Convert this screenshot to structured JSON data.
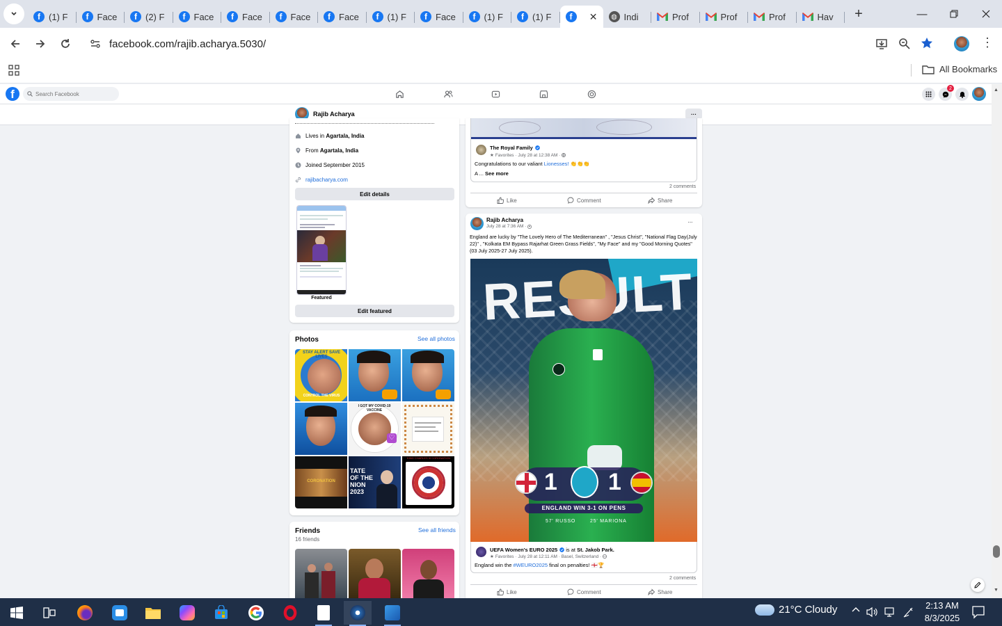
{
  "browser": {
    "tabs": [
      {
        "label": "(1) F",
        "icon": "facebook-icon"
      },
      {
        "label": "Face",
        "icon": "facebook-icon"
      },
      {
        "label": "(2) F",
        "icon": "facebook-icon"
      },
      {
        "label": "Face",
        "icon": "facebook-icon"
      },
      {
        "label": "Face",
        "icon": "facebook-icon"
      },
      {
        "label": "Face",
        "icon": "facebook-icon"
      },
      {
        "label": "Face",
        "icon": "facebook-icon"
      },
      {
        "label": "(1) F",
        "icon": "facebook-icon"
      },
      {
        "label": "Face",
        "icon": "facebook-icon"
      },
      {
        "label": "(1) F",
        "icon": "facebook-icon"
      },
      {
        "label": "(1) F",
        "icon": "facebook-icon"
      },
      {
        "label": "",
        "icon": "facebook-icon",
        "active": true
      },
      {
        "label": "Indi",
        "icon": "globe-icon"
      },
      {
        "label": "Prof",
        "icon": "gmail-icon"
      },
      {
        "label": "Prof",
        "icon": "gmail-icon"
      },
      {
        "label": "Prof",
        "icon": "gmail-icon"
      },
      {
        "label": "Hav",
        "icon": "gmail-icon"
      }
    ],
    "url": "facebook.com/rajib.acharya.5030/",
    "bookmarks_label": "All Bookmarks"
  },
  "fb": {
    "search_placeholder": "Search Facebook",
    "messenger_badge": "2",
    "profile_name": "Rajib Acharya",
    "more_label": "···"
  },
  "intro": {
    "items": [
      {
        "prefix": "Lives in ",
        "bold": "Agartala, India",
        "icon": "home-icon"
      },
      {
        "prefix": "From ",
        "bold": "Agartala, India",
        "icon": "location-icon"
      },
      {
        "prefix": "Joined September 2015",
        "bold": "",
        "icon": "clock-icon"
      }
    ],
    "website": "rajibacharya.com",
    "edit_details": "Edit details",
    "featured_label": "Featured",
    "edit_featured": "Edit featured"
  },
  "photos": {
    "title": "Photos",
    "see_all": "See all photos",
    "tile_texts": {
      "stay_alert": "STAY ALERT  SAVE LIVES",
      "control": "CONTROL THE VIRUS",
      "vaccine": "I GOT MY COVID-19 VACCINE",
      "coronation": "CORONATION",
      "state": "TATE OF THE NION 2023",
      "charles": "KING CHARLES III CORONATION"
    }
  },
  "friends": {
    "title": "Friends",
    "count": "16 friends",
    "see_all": "See all friends"
  },
  "shared_post": {
    "author": "The Royal Family",
    "meta": "Favorites · July 28 at 12:38 AM ·",
    "text_prefix": "Congratulations to our valiant ",
    "text_link": "Lionesses!",
    "text_emoji": "👏👏👏",
    "more_prefix": "A ... ",
    "see_more": "See more",
    "comments": "2 comments"
  },
  "actions": {
    "like": "Like",
    "comment": "Comment",
    "share": "Share"
  },
  "post2": {
    "author": "Rajib Acharya",
    "meta": "July 28 at 7:36 AM ·",
    "text": "England are lucky by \"The Lovely Hero of The Mediterranean\" , \"Jesus Christ\", \"National Flag Day(July 22)\" , \"Kolkata EM Bypass Rajarhat Green Grass Fields\", \"My Face\" and my \"Good Morning Quotes\"(03 July 2025-27 July 2025).",
    "graphic": {
      "headline": "RESULT",
      "score_left": "1",
      "score_right": "1",
      "result_line": "ENGLAND WIN 3-1 ON PENS",
      "scorer_left": "57' RUSSO",
      "scorer_right": "25' MARIONA"
    },
    "shared_author": "UEFA Women's EURO 2025",
    "shared_is_at": " is at ",
    "shared_place": "St. Jakob Park.",
    "shared_meta": "Favorites · July 28 at 12:11 AM · Basel, Switzerland ·",
    "shared_text_prefix": "England win the ",
    "shared_hashtag": "#WEURO2025",
    "shared_text_suffix": " final on penalties! 🏴󠁧󠁢󠁥󠁮󠁧󠁿🏆",
    "comments": "2 comments"
  },
  "taskbar": {
    "weather": "21°C  Cloudy",
    "time": "2:13 AM",
    "date": "8/3/2025"
  }
}
